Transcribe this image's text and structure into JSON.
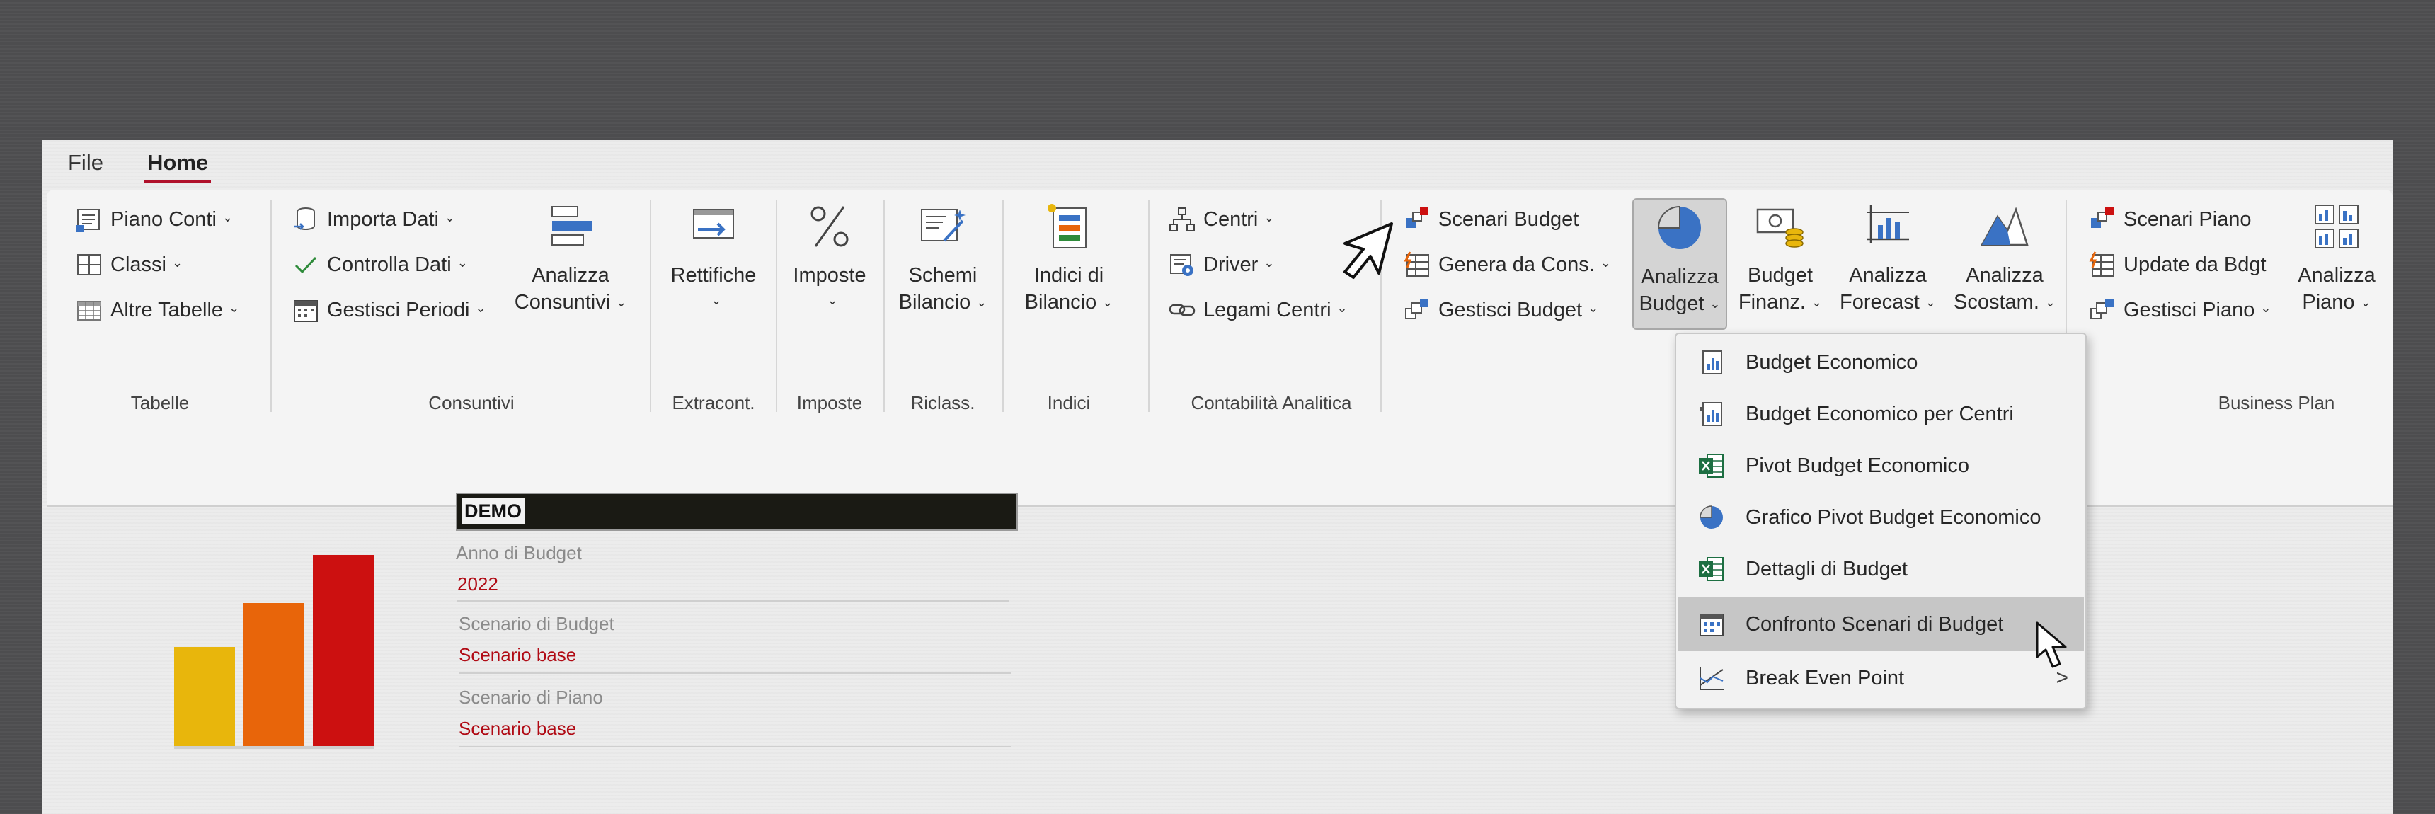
{
  "menu": {
    "file": "File",
    "home": "Home"
  },
  "ribbon": {
    "tabelle": {
      "piano_conti": "Piano Conti",
      "classi": "Classi",
      "altre_tabelle": "Altre Tabelle",
      "label": "Tabelle"
    },
    "consuntivi": {
      "importa_dati": "Importa Dati",
      "controlla_dati": "Controlla Dati",
      "gestisci_periodi": "Gestisci Periodi",
      "analizza_line1": "Analizza",
      "analizza_line2": "Consuntivi",
      "label": "Consuntivi"
    },
    "extracont": {
      "rettifiche": "Rettifiche",
      "label": "Extracont."
    },
    "imposte": {
      "imposte": "Imposte",
      "label": "Imposte"
    },
    "riclass": {
      "schemi_line1": "Schemi",
      "schemi_line2": "Bilancio",
      "label": "Riclass."
    },
    "indici": {
      "indici_line1": "Indici di",
      "indici_line2": "Bilancio",
      "label": "Indici"
    },
    "contabilita": {
      "centri": "Centri",
      "driver": "Driver",
      "legami_centri": "Legami Centri",
      "label": "Contabilità Analitica"
    },
    "budget": {
      "scenari_budget": "Scenari Budget",
      "genera_da_cons": "Genera da Cons.",
      "gestisci_budget": "Gestisci Budget",
      "analizza_budget_line1": "Analizza",
      "analizza_budget_line2": "Budget",
      "budget_finanz_line1": "Budget",
      "budget_finanz_line2": "Finanz.",
      "analizza_forecast_line1": "Analizza",
      "analizza_forecast_line2": "Forecast",
      "analizza_scostam_line1": "Analizza",
      "analizza_scostam_line2": "Scostam."
    },
    "business_plan": {
      "scenari_piano": "Scenari Piano",
      "update_da_bdgt": "Update da Bdgt",
      "gestisci_piano": "Gestisci Piano",
      "analizza_piano_line1": "Analizza",
      "analizza_piano_line2": "Piano",
      "label": "Business Plan"
    }
  },
  "dropdown": {
    "items": [
      {
        "label": "Budget Economico"
      },
      {
        "label": "Budget Economico per Centri"
      },
      {
        "label": "Pivot Budget Economico"
      },
      {
        "label": "Grafico Pivot Budget Economico"
      },
      {
        "label": "Dettagli di Budget"
      },
      {
        "label": "Confronto Scenari di Budget"
      },
      {
        "label": "Break Even Point"
      }
    ],
    "submenu_arrow": ">"
  },
  "main": {
    "company": "DEMO",
    "anno_label": "Anno di Budget",
    "anno_value": "2022",
    "scenario_budget_label": "Scenario di Budget",
    "scenario_budget_value": "Scenario base",
    "scenario_piano_label": "Scenario di Piano",
    "scenario_piano_value": "Scenario base"
  },
  "logo_colors": [
    "#e8b60c",
    "#e8650a",
    "#cc1010"
  ],
  "accent": "#b0102a",
  "chevron": "⌄"
}
